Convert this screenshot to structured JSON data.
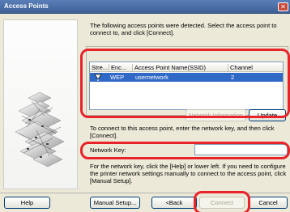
{
  "window": {
    "title": "Access Points"
  },
  "intro_text": "The following access points were detected. Select the access point to connect to, and click [Connect].",
  "access_points_table": {
    "columns": [
      "Stre...",
      "Enc...",
      "Access Point Name(SSID)",
      "Channel"
    ],
    "rows": [
      {
        "strength_icon": "signal-strength-icon",
        "encryption": "WEP",
        "ssid": "usernetwork",
        "channel": "2"
      }
    ]
  },
  "buttons": {
    "network_information": "Network Information",
    "update": "Update",
    "help": "Help",
    "manual_setup": "Manual Setup...",
    "back": "<Back",
    "connect": "Connect",
    "cancel": "Cancel"
  },
  "instruction_text": "To connect to this access point, enter the network key, and then click [Connect].",
  "network_key": {
    "label": "Network Key:",
    "value": ""
  },
  "hint_text": "For the network key, click the [Help] or lower left. If you need to configure the printer network settings manually to connect to the access point, click [Manual Setup].",
  "colors": {
    "titlebar": "#3d5f94",
    "selection": "#3169c6",
    "annotation": "#e8232a"
  }
}
